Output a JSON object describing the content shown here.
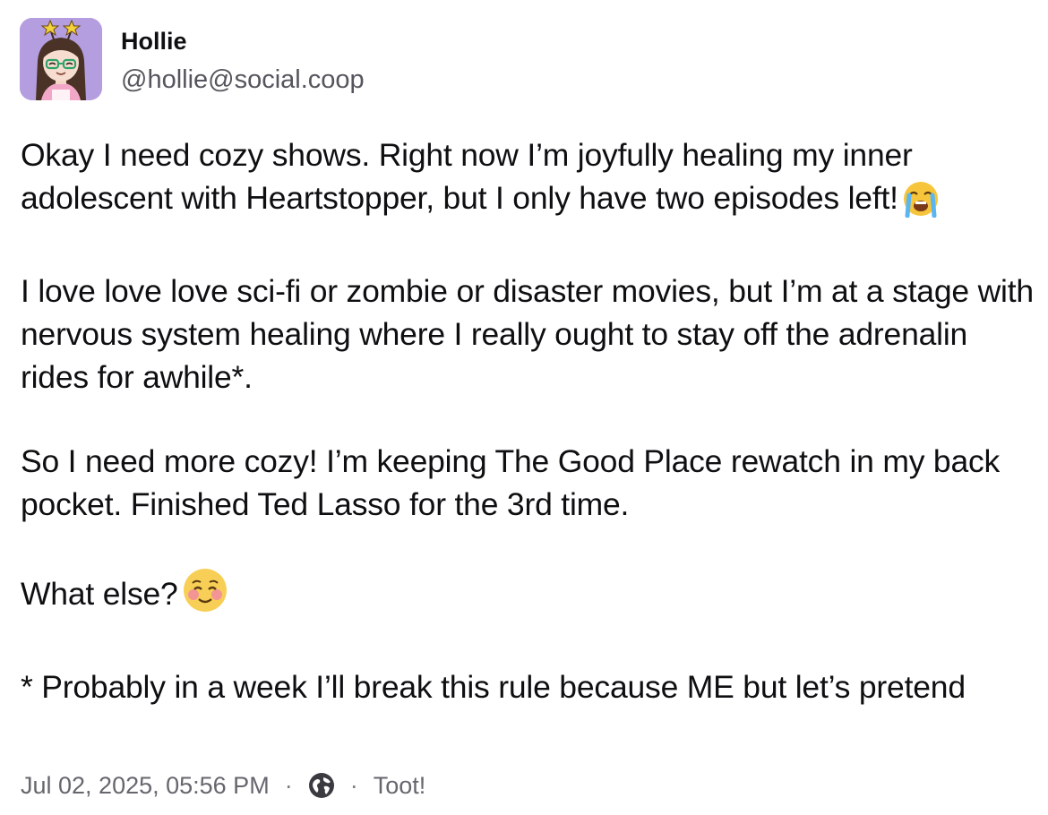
{
  "author": {
    "display_name": "Hollie",
    "handle": "@hollie@social.coop",
    "avatar_icon": "avatar-illustration"
  },
  "post": {
    "paragraphs": [
      {
        "text": "Okay I need cozy shows. Right now I’m joyfully healing my inner adolescent with Heartstopper, but I only have two episodes left!",
        "emoji": "loudly-crying-face-emoji"
      },
      {
        "text": "I love love love sci-fi or zombie or disaster movies, but I’m at a stage with nervous system healing where I really ought to stay off the adrenalin rides for awhile*."
      },
      {
        "text": "So I need more cozy! I’m keeping The Good Place rewatch in my back pocket. Finished Ted Lasso for the 3rd time."
      },
      {
        "text": "What else?",
        "emoji": "smiling-face-emoji"
      },
      {
        "text": "* Probably in a week I’ll break this rule because ME but let’s pretend"
      }
    ]
  },
  "footer": {
    "timestamp": "Jul 02, 2025, 05:56 PM",
    "separator": "·",
    "visibility_icon": "globe-icon",
    "app_label": "Toot!"
  },
  "colors": {
    "text": "#0f0f12",
    "muted": "#66666e",
    "avatar_bg": "#b49ee0"
  }
}
